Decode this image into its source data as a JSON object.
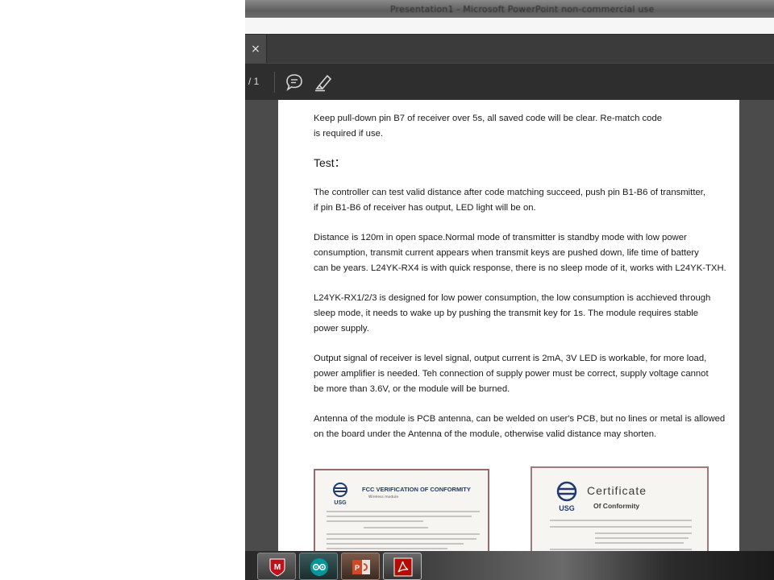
{
  "window": {
    "title": "Presentation1 - Microsoft PowerPoint non-commercial use"
  },
  "tab": {
    "close_label": "×"
  },
  "toolbar": {
    "page_indicator": "/ 1",
    "comment_icon": "comment-icon",
    "highlight_icon": "highlighter-icon"
  },
  "document": {
    "p1": "Keep pull-down pin B7 of receiver over 5s, all saved code will be clear. Re-match code\nis required if use.",
    "heading": "Test：",
    "p2": "The controller can test valid distance after code matching succeed, push pin B1-B6 of transmitter,\nif pin B1-B6 of receiver has output, LED light will be on.",
    "p3": "Distance is 120m in open space.Normal mode of transmitter is standby mode with low power\nconsumption, transmit current appears when transmit keys are pushed down, life time of battery\ncan be years. L24YK-RX4 is with quick response, there is no sleep mode of it, works with L24YK-TXH.",
    "p4": "L24YK-RX1/2/3 is designed for low power consumption, the low consumption is acchieved through\n sleep mode, it needs to wake up by pushing the transmit key for 1s. The module requires stable\npower supply.",
    "p5": "Output signal of receiver is level signal, output current is 2mA, 3V LED is workable, for more load,\npower amplifier is needed. Teh connection of supply power must be correct, supply voltage cannot\nbe more than 3.6V, or the module will be burned.",
    "p6": "Antenna of the module is PCB antenna, can be welded on user's PCB, but no lines or metal is allowed\n on the board under the Antenna of the module, otherwise valid distance may shorten."
  },
  "certificates": {
    "fcc_title": "FCC VERIFICATION OF CONFORMITY",
    "fcc_logo_text": "USG",
    "fcc_sub": "Wireless module",
    "cert_title": "Certificate",
    "cert_sub": "Of Conformity",
    "cert_logo_text": "USG"
  },
  "taskbar": {
    "apps": [
      "mcafee-icon",
      "arduino-icon",
      "powerpoint-icon",
      "acrobat-icon"
    ]
  }
}
